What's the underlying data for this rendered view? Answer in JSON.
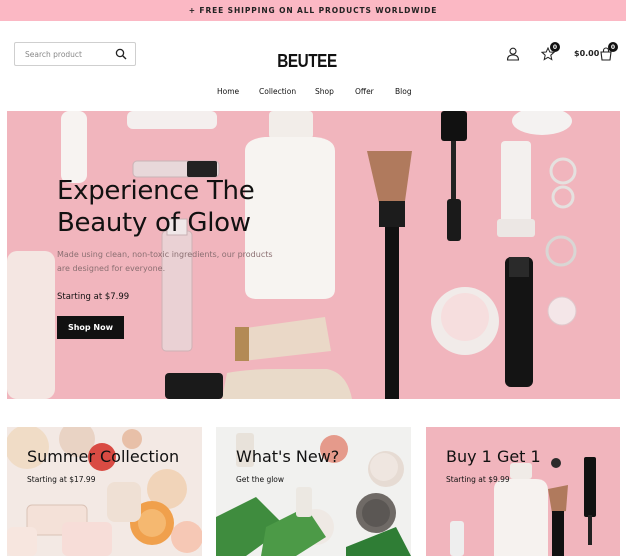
{
  "announcement": "+ FREE SHIPPING ON ALL PRODUCTS WORLDWIDE",
  "header": {
    "search_placeholder": "Search product",
    "logo": "BEUTEE",
    "wishlist_count": "0",
    "cart_total": "$0.00",
    "cart_count": "0"
  },
  "nav": {
    "items": [
      {
        "label": "Home"
      },
      {
        "label": "Collection"
      },
      {
        "label": "Shop"
      },
      {
        "label": "Offer"
      },
      {
        "label": "Blog"
      }
    ]
  },
  "hero": {
    "title_line1": "Experience The",
    "title_line2": "Beauty of Glow",
    "description": "Made using clean, non-toxic ingredients, our products are designed for everyone.",
    "price": "Starting at $7.99",
    "cta": "Shop Now",
    "bg_color": "#f1b5bd"
  },
  "cards": [
    {
      "title": "Summer Collection",
      "subtitle": "Starting at $17.99"
    },
    {
      "title": "What's New?",
      "subtitle": "Get the glow"
    },
    {
      "title": "Buy 1 Get 1",
      "subtitle": "Starting at $9.99"
    }
  ],
  "icons": {
    "search": "search-icon",
    "user": "user-icon",
    "wishlist": "star-icon",
    "cart": "cart-icon"
  },
  "colors": {
    "announcement_bg": "#fbb8c4",
    "accent_dark": "#111111"
  }
}
